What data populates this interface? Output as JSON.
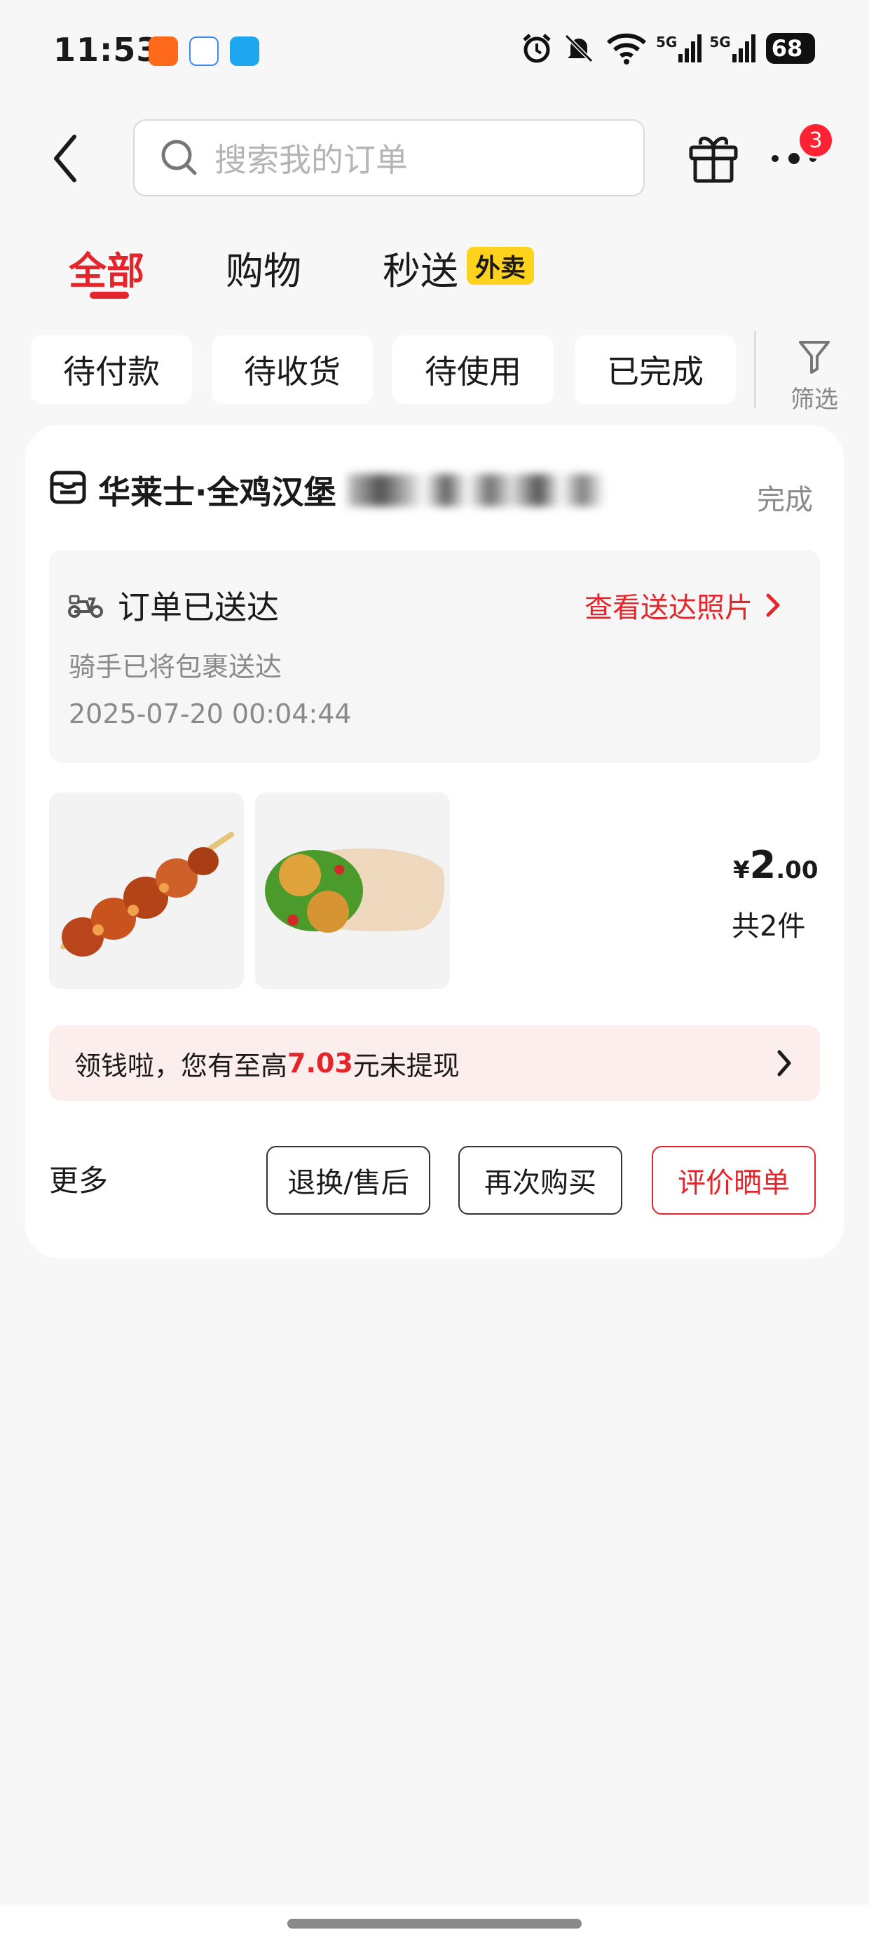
{
  "status_bar": {
    "time": "11:53",
    "battery": "68",
    "network_labels": [
      "5G",
      "5G"
    ],
    "icons": [
      "taobao-icon",
      "app-icon-blue",
      "eleme-icon",
      "alarm-icon",
      "mute-bell-icon",
      "wifi-icon",
      "signal-icon",
      "signal-icon",
      "battery-icon"
    ]
  },
  "header": {
    "search_placeholder": "搜索我的订单",
    "more_badge": "3"
  },
  "tabs": [
    {
      "label": "全部",
      "active": true
    },
    {
      "label": "购物",
      "active": false
    },
    {
      "label": "秒送",
      "badge": "外卖",
      "active": false
    }
  ],
  "filters": {
    "chips": [
      "待付款",
      "待收货",
      "待使用",
      "已完成"
    ],
    "filter_label": "筛选"
  },
  "order": {
    "store_name": "华莱士·全鸡汉堡",
    "status": "完成",
    "delivery": {
      "title": "订单已送达",
      "photo_link": "查看送达照片",
      "description": "骑手已将包裹送达",
      "time": "2025-07-20 00:04:44"
    },
    "price": {
      "symbol": "¥",
      "integer": "2",
      "decimal": ".00"
    },
    "item_count": "共2件",
    "promo": {
      "prefix": "领钱啦，您有至高",
      "amount": "7.03",
      "suffix": "元未提现"
    },
    "more_label": "更多",
    "actions": {
      "return": "退换/售后",
      "rebuy": "再次购买",
      "review": "评价晒单"
    }
  },
  "colors": {
    "accent_red": "#e5252c",
    "badge_yellow": "#ffd21e",
    "background": "#f7f7f7"
  }
}
